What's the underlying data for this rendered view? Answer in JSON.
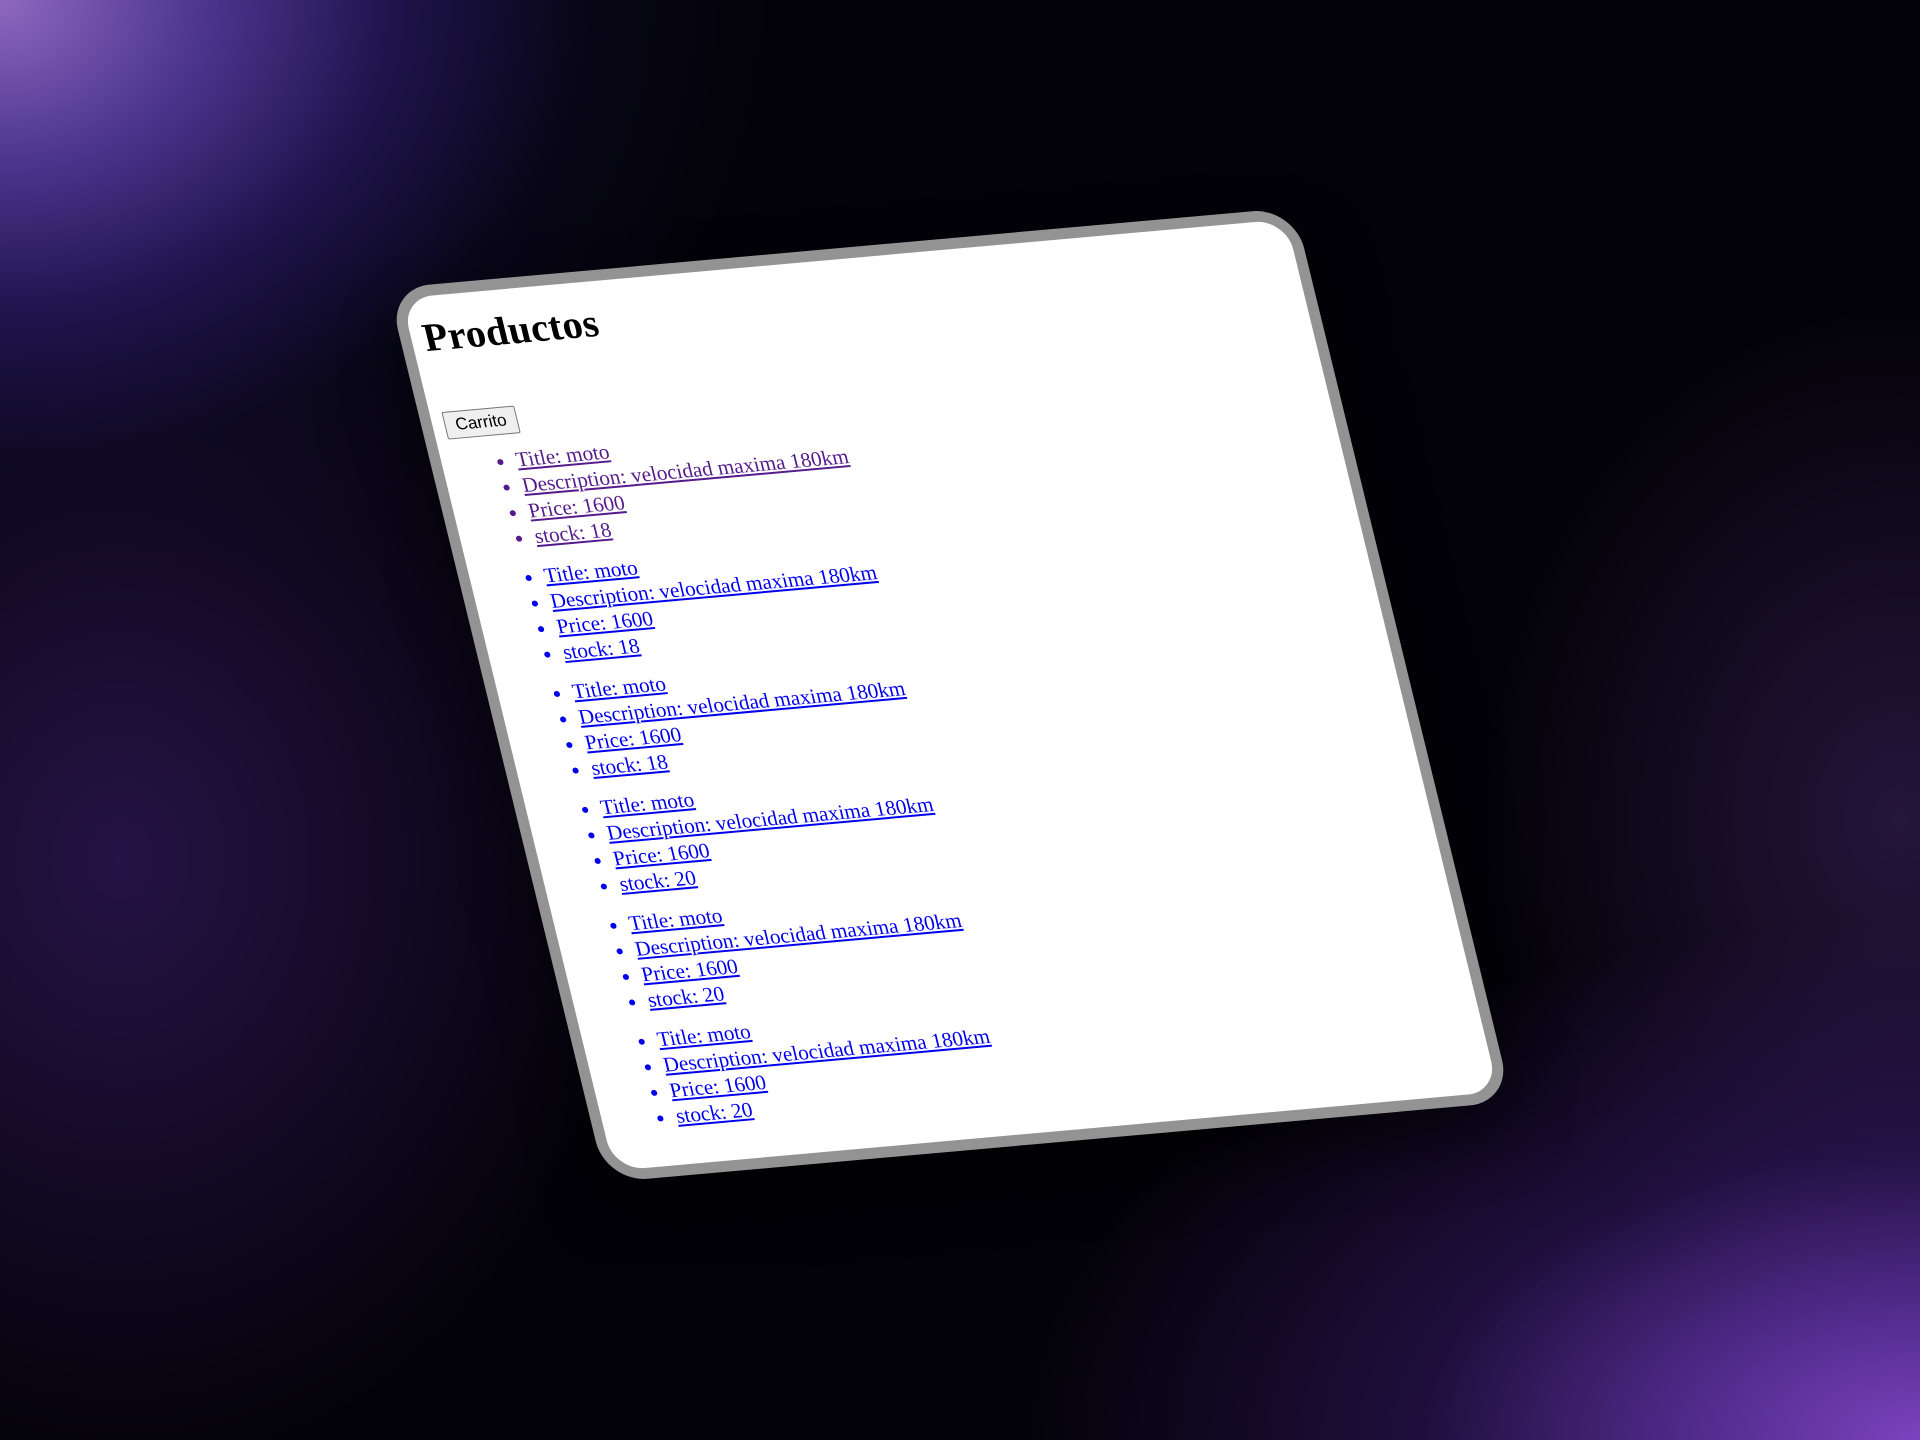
{
  "page": {
    "title": "Productos",
    "cart_button": "Carrito"
  },
  "products": [
    {
      "title": "Title: moto",
      "description": "Description: velocidad maxima 180km",
      "price": "Price: 1600",
      "stock": "stock: 18"
    },
    {
      "title": "Title: moto",
      "description": "Description: velocidad maxima 180km",
      "price": "Price: 1600",
      "stock": "stock: 18"
    },
    {
      "title": "Title: moto",
      "description": "Description: velocidad maxima 180km",
      "price": "Price: 1600",
      "stock": "stock: 18"
    },
    {
      "title": "Title: moto",
      "description": "Description: velocidad maxima 180km",
      "price": "Price: 1600",
      "stock": "stock: 20"
    },
    {
      "title": "Title: moto",
      "description": "Description: velocidad maxima 180km",
      "price": "Price: 1600",
      "stock": "stock: 20"
    },
    {
      "title": "Title: moto",
      "description": "Description: velocidad maxima 180km",
      "price": "Price: 1600",
      "stock": "stock: 20"
    }
  ],
  "colors": {
    "link": "#0000ee",
    "visited_link": "#551a8b",
    "frame": "#939393",
    "background": "#030208"
  }
}
